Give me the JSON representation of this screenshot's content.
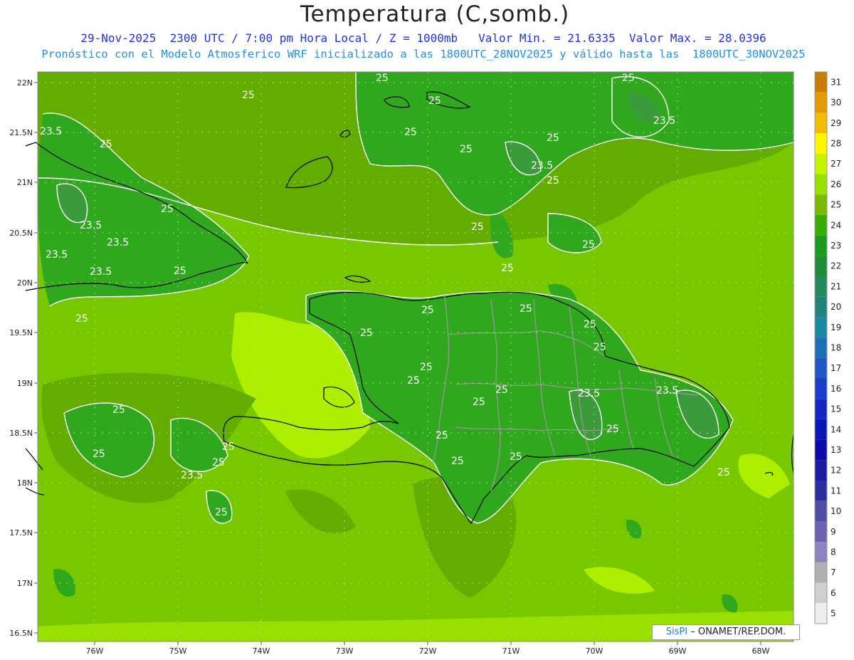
{
  "title": "Temperatura (C,somb.)",
  "subtitle_line1": "29-Nov-2025  2300 UTC / 7:00 pm Hora Local / Z = 1000mb   Valor Min. = 21.6335  Valor Max. = 28.0396",
  "subtitle_line2": "Pronóstico con el Modelo Atmosferico WRF inicializado a las 1800UTC_28NOV2025 y válido hasta las  1800UTC_30NOV2025",
  "lat_labels": [
    "22N",
    "21.5N",
    "21N",
    "20.5N",
    "20N",
    "19.5N",
    "19N",
    "18.5N",
    "18N",
    "17.5N",
    "17N",
    "16.5N"
  ],
  "lon_labels": [
    "76W",
    "75W",
    "74W",
    "73W",
    "72W",
    "71W",
    "70W",
    "69W",
    "68W"
  ],
  "colorbar": {
    "labels": [
      "31",
      "30",
      "29",
      "28",
      "27",
      "26",
      "25",
      "24",
      "23",
      "22",
      "21",
      "20",
      "19",
      "18",
      "17",
      "16",
      "15",
      "14",
      "13",
      "12",
      "11",
      "10",
      "9",
      "8",
      "7",
      "6",
      "5"
    ],
    "colors": [
      "#c87f00",
      "#e49a00",
      "#f2bd00",
      "#fbf600",
      "#c4f400",
      "#97e000",
      "#7cb800",
      "#37ae00",
      "#1b9c1e",
      "#228b3a",
      "#238a5c",
      "#23827a",
      "#1b8aa0",
      "#1b6fb4",
      "#1f57c4",
      "#1c3fc8",
      "#1427c2",
      "#0a18b3",
      "#0b0ba6",
      "#1b1ba0",
      "#2e2f9c",
      "#4d4ea6",
      "#7060b0",
      "#8c84be",
      "#b0b0b0",
      "#cfcfcf",
      "#eeeeee"
    ]
  },
  "map_colors": {
    "ocean_base": "#78c800",
    "band_26": "#8fd600",
    "band_25": "#5aac00",
    "band_24": "#2da81c",
    "band_27": "#aeef00",
    "contour": "#ffffff",
    "coast": "#000000",
    "province_border": "#9a9a9a"
  },
  "contour_labels": [
    "25",
    "25",
    "25",
    "25",
    "25",
    "25",
    "25",
    "25",
    "23.5",
    "23.5",
    "25",
    "23.5",
    "23.5",
    "23.5",
    "23.5",
    "25",
    "25",
    "25",
    "23.5",
    "25",
    "25",
    "25",
    "25",
    "25",
    "25",
    "25",
    "25",
    "25",
    "25",
    "23.5",
    "25",
    "23.5",
    "25",
    "25",
    "25",
    "25",
    "25",
    "25",
    "23.5",
    "25",
    "25",
    "25",
    "25",
    "25"
  ],
  "credit": {
    "brand": "SisPI",
    "text": " – ONAMET/REP.DOM."
  }
}
